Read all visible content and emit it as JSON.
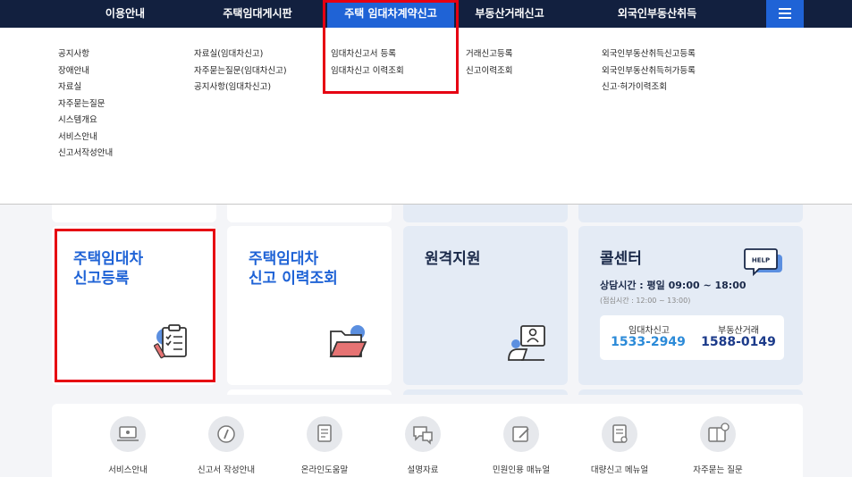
{
  "nav": {
    "items": [
      "이용안내",
      "주택임대게시판",
      "주택 임대차계약신고",
      "부동산거래신고",
      "외국인부동산취득"
    ]
  },
  "menu": {
    "col1": [
      "공지사항",
      "장애안내",
      "자료실",
      "자주묻는질문",
      "시스템개요",
      "서비스안내",
      "신고서작성안내"
    ],
    "col2": [
      "자료실(임대차신고)",
      "자주묻는질문(임대차신고)",
      "공지사항(임대차신고)"
    ],
    "col3": [
      "임대차신고서 등록",
      "임대차신고 이력조회"
    ],
    "col4": [
      "거래신고등록",
      "신고이력조회"
    ],
    "col5": [
      "외국인부동산취득신고등록",
      "외국인부동산취득허가등록",
      "신고·허가이력조회"
    ]
  },
  "cards": {
    "register": {
      "line1": "주택임대차",
      "line2": "신고등록"
    },
    "history": {
      "line1": "주택임대차",
      "line2": "신고 이력조회"
    },
    "remote": {
      "title": "원격지원"
    },
    "callcenter": {
      "title": "콜센터",
      "help_badge": "HELP",
      "hours": "상담시간 : 평일 09:00 ~ 18:00",
      "lunch": "(점심시간 : 12:00 ~ 13:00)",
      "lease_label": "임대차신고",
      "lease_number": "1533-2949",
      "realestate_label": "부동산거래",
      "realestate_number": "1588-0149"
    }
  },
  "quick": [
    "서비스안내",
    "신고서 작성안내",
    "온라인도움말",
    "설명자료",
    "민원인용 매뉴얼",
    "대량신고 메뉴얼",
    "자주묻는 질문"
  ],
  "colors": {
    "nav_bg": "#12203f",
    "accent": "#1f63d6",
    "highlight": "#e60012",
    "number_blue": "#2b8ad8",
    "number_navy": "#1b3a8a"
  }
}
